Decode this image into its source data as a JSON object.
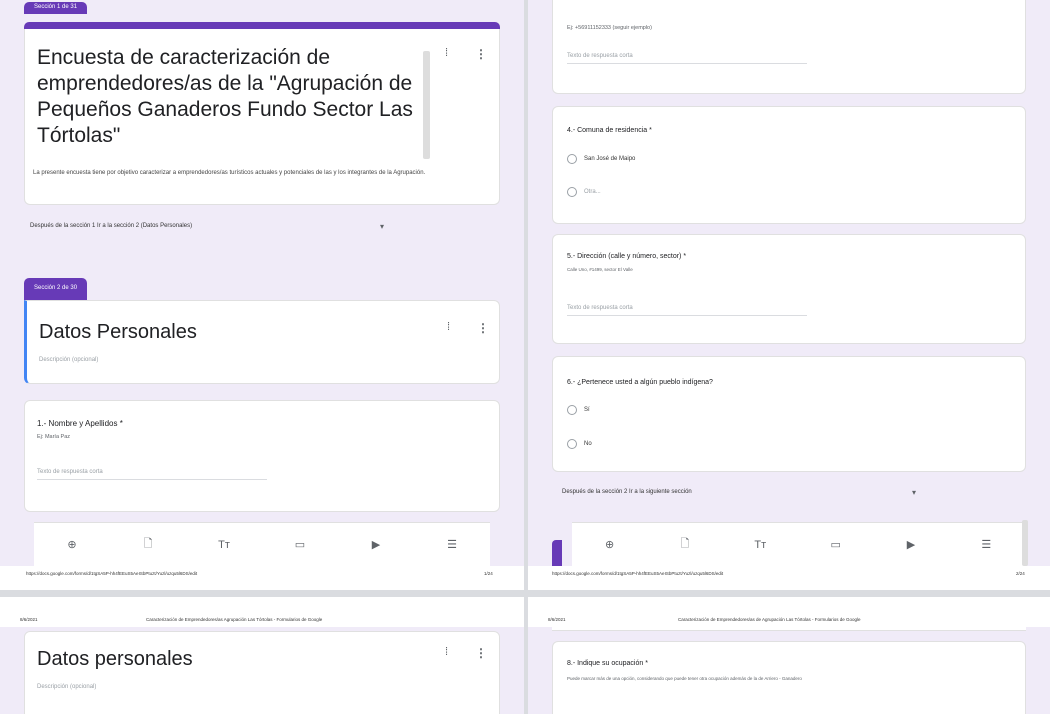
{
  "top_left": {
    "section1_tab": "Sección 1 de 31",
    "form_title": "Encuesta de caracterización de emprendedores/as de la \"Agrupación de Pequeños Ganaderos  Fundo Sector Las Tórtolas\"",
    "form_description": "La presente encuesta tiene por objetivo caracterizar a emprendedores/as turísticos actuales y potenciales de las y los integrantes de la Agrupación.",
    "after_section1": "Después de la sección 1   Ir a la sección 2 (Datos Personales)",
    "section2_tab": "Sección 2 de 30",
    "section2_title": "Datos Personales",
    "section2_desc_placeholder": "Descripción (opcional)",
    "q1_label": "1.- Nombre y Apellidos *",
    "q1_hint": "Ej: María Paz",
    "q1_placeholder": "Texto de respuesta corta",
    "url": "https://docs.google.com/forms/d/1tgSA5P-hh4fEEuS5AeISbPtuzt/Yuzl/uzqu5l6DS/edit",
    "page_num": "1/24"
  },
  "top_right": {
    "q3_hint": "Ej: +56911152333 (seguir ejemplo)",
    "q3_placeholder": "Texto de respuesta corta",
    "q4_label": "4.- Comuna de residencia *",
    "q4_options": [
      "San José de Maipo",
      "Otra..."
    ],
    "q5_label": "5.- Dirección (calle y número, sector)  *",
    "q5_hint": "Calle Uno, #1499, sector El Valle",
    "q5_placeholder": "Texto de respuesta corta",
    "q6_label": "6.- ¿Pertenece usted a algún pueblo indígena?",
    "q6_options": [
      "Sí",
      "No"
    ],
    "after_section2": "Después de la sección 2   Ir a la siguiente sección",
    "url": "https://docs.google.com/forms/d/1tgSA5P-hh4fEEuS5AeISbPtuzt/Yuzl/uzqu5l6DS/edit",
    "page_num": "2/24"
  },
  "bottom_left": {
    "date": "8/6/2021",
    "page_header": "Caracterización de Emprendedores/as Agrupación Las Tórtolas - Formularios de Google",
    "title": "Datos personales",
    "desc_placeholder": "Descripción (opcional)"
  },
  "bottom_right": {
    "date": "8/6/2021",
    "page_header": "Caracterización de Emprendedores/as de Agrupación Las Tórtolas - Formularios de Google",
    "q8_label": "8.- Indique su ocupación  *",
    "q8_hint": "Puede marcar más de una opción, considerando que puede tener otra ocupación además de la de Arriero - Ganadero"
  },
  "toolbar_icons": [
    "add-circle-icon",
    "import-icon",
    "title-icon",
    "image-icon",
    "video-icon",
    "section-icon"
  ],
  "colors": {
    "accent": "#673ab7",
    "lavender": "#f0ebf8"
  }
}
